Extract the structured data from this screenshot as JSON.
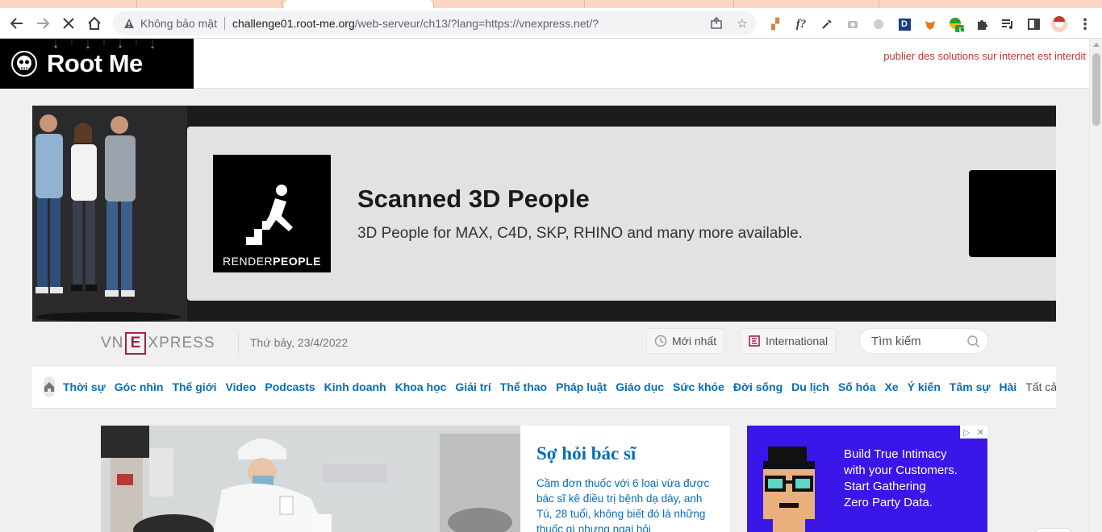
{
  "browser": {
    "security_label": "Không bảo mật",
    "url_host": "challenge01.root-me.org",
    "url_path": "/web-serveur/ch13/?lang=https://vnexpress.net/?",
    "extensions": [
      "ruler-extension-icon",
      "f?",
      "eyedropper-icon",
      "camera-icon",
      "circle-icon",
      "D",
      "fox-extension-icon",
      "LT",
      "puzzle-icon"
    ]
  },
  "rootme": {
    "logo_text": "Root Me",
    "warning": "publier des solutions sur internet est interdit"
  },
  "ad_banner": {
    "brand_light": "RENDER",
    "brand_bold": "PEOPLE",
    "headline": "Scanned 3D People",
    "subline": "3D People for MAX, C4D, SKP, RHINO and many more available."
  },
  "vnexpress": {
    "logo_left": "VN",
    "logo_e": "E",
    "logo_right": "XPRESS",
    "date": "Thứ bảy, 23/4/2022",
    "latest_label": "Mới nhất",
    "international_label": "International",
    "search_placeholder": "Tìm kiếm",
    "nav": [
      "Thời sự",
      "Góc nhìn",
      "Thế giới",
      "Video",
      "Podcasts",
      "Kinh doanh",
      "Khoa học",
      "Giải trí",
      "Thể thao",
      "Pháp luật",
      "Giáo dục",
      "Sức khỏe",
      "Đời sống",
      "Du lịch",
      "Số hóa",
      "Xe",
      "Ý kiến",
      "Tâm sự",
      "Hài"
    ],
    "nav_all": "Tất cả",
    "featured": {
      "title": "Sợ hỏi bác sĩ",
      "description": "Cầm đơn thuốc với 6 loại vừa được bác sĩ kê điều trị bệnh dạ dày, anh Tú, 28 tuổi, không biết đó là những thuốc gì nhưng ngại hỏi"
    },
    "side_ad": {
      "line1": "Build True Intimacy",
      "line2": "with your Customers.",
      "line3": "Start Gathering",
      "line4": "Zero Party Data."
    }
  },
  "colors": {
    "vn_blue": "#076db6",
    "vn_red": "#9f224e",
    "rootme_warning": "#c0392b",
    "side_ad_bg": "#3a16e8"
  }
}
